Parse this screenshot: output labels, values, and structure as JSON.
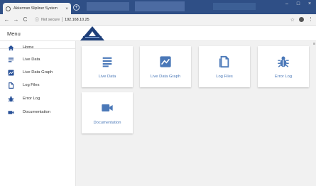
{
  "browser": {
    "tab_title": "Akkerman Slipliner System",
    "tab_close": "×",
    "new_tab": "+",
    "window_controls": [
      "–",
      "□",
      "×"
    ],
    "nav": {
      "back": "←",
      "forward": "→",
      "reload": "C"
    },
    "url_info_icon": "ⓘ",
    "security_label": "Not secure",
    "url": "192.168.10.25",
    "bookmark_star": "☆",
    "menu_kebab": "⋮"
  },
  "app": {
    "menu_title": "Menu",
    "accent_color": "#4a78b8",
    "sidebar": [
      {
        "icon": "home-icon",
        "label": "Home"
      },
      {
        "icon": "live-data-icon",
        "label": "Live Data"
      },
      {
        "icon": "live-data-graph-icon",
        "label": "Live Data Graph"
      },
      {
        "icon": "log-files-icon",
        "label": "Log Files"
      },
      {
        "icon": "error-log-bug-icon",
        "label": "Error Log"
      },
      {
        "icon": "documentation-video-icon",
        "label": "Documentation"
      }
    ],
    "cards": [
      {
        "icon": "live-data-icon",
        "label": "Live Data"
      },
      {
        "icon": "live-data-graph-icon",
        "label": "Live Data Graph"
      },
      {
        "icon": "log-files-icon",
        "label": "Log Files"
      },
      {
        "icon": "error-log-bug-icon",
        "label": "Error Log"
      },
      {
        "icon": "documentation-video-icon",
        "label": "Documentation"
      }
    ]
  }
}
